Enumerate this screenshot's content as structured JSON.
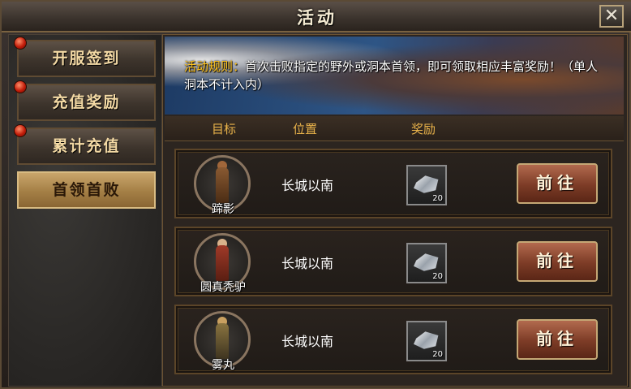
{
  "window": {
    "title": "活动",
    "close_icon": "close-icon"
  },
  "sidebar": {
    "items": [
      {
        "label": "开服签到",
        "active": false,
        "has_badge": true
      },
      {
        "label": "充值奖励",
        "active": false,
        "has_badge": true
      },
      {
        "label": "累计充值",
        "active": false,
        "has_badge": true
      },
      {
        "label": "首领首败",
        "active": true,
        "has_badge": false
      }
    ]
  },
  "banner": {
    "rule_label": "活动规则：",
    "rule_text": "首次击败指定的野外或洞本首领，即可领取相应丰富奖励！（单人洞本不计入内）"
  },
  "columns": {
    "target": "目标",
    "location": "位置",
    "reward": "奖励"
  },
  "rows": [
    {
      "boss": "蹄影",
      "location": "长城以南",
      "reward_count": "20",
      "button": "前往"
    },
    {
      "boss": "圆真秃驴",
      "location": "长城以南",
      "reward_count": "20",
      "button": "前往"
    },
    {
      "boss": "雾丸",
      "location": "长城以南",
      "reward_count": "20",
      "button": "前往"
    }
  ],
  "colors": {
    "accent_gold": "#e8b24a",
    "rule_label": "#ffc21a",
    "badge_red": "#c21d0a"
  }
}
